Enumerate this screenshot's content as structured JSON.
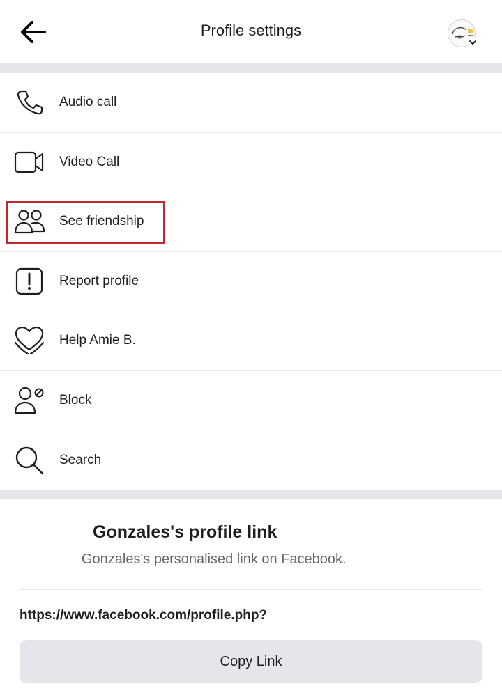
{
  "header": {
    "back_icon": "arrow-left-icon",
    "title": "Profile settings",
    "avatar_icon": "profile-avatar",
    "avatar_caret_icon": "chevron-down-icon"
  },
  "menu": {
    "items": [
      {
        "label": "Audio call",
        "icon": "phone-icon"
      },
      {
        "label": "Video Call",
        "icon": "video-camera-icon"
      },
      {
        "label": "See friendship",
        "icon": "friends-icon",
        "highlighted": true
      },
      {
        "label": "Report profile",
        "icon": "report-icon"
      },
      {
        "label": "Help Amie B.",
        "icon": "heart-hands-icon"
      },
      {
        "label": "Block",
        "icon": "block-user-icon"
      },
      {
        "label": "Search",
        "icon": "search-icon"
      }
    ]
  },
  "profile_link": {
    "title": "Gonzales's profile link",
    "subtitle": "Gonzales's personalised link on Facebook.",
    "url": "https://www.facebook.com/profile.php?",
    "copy_label": "Copy Link"
  },
  "colors": {
    "highlight_border": "#c0282e",
    "divider": "#e4e6eb",
    "button_bg": "#e4e6eb",
    "secondary_text": "#65676b"
  }
}
